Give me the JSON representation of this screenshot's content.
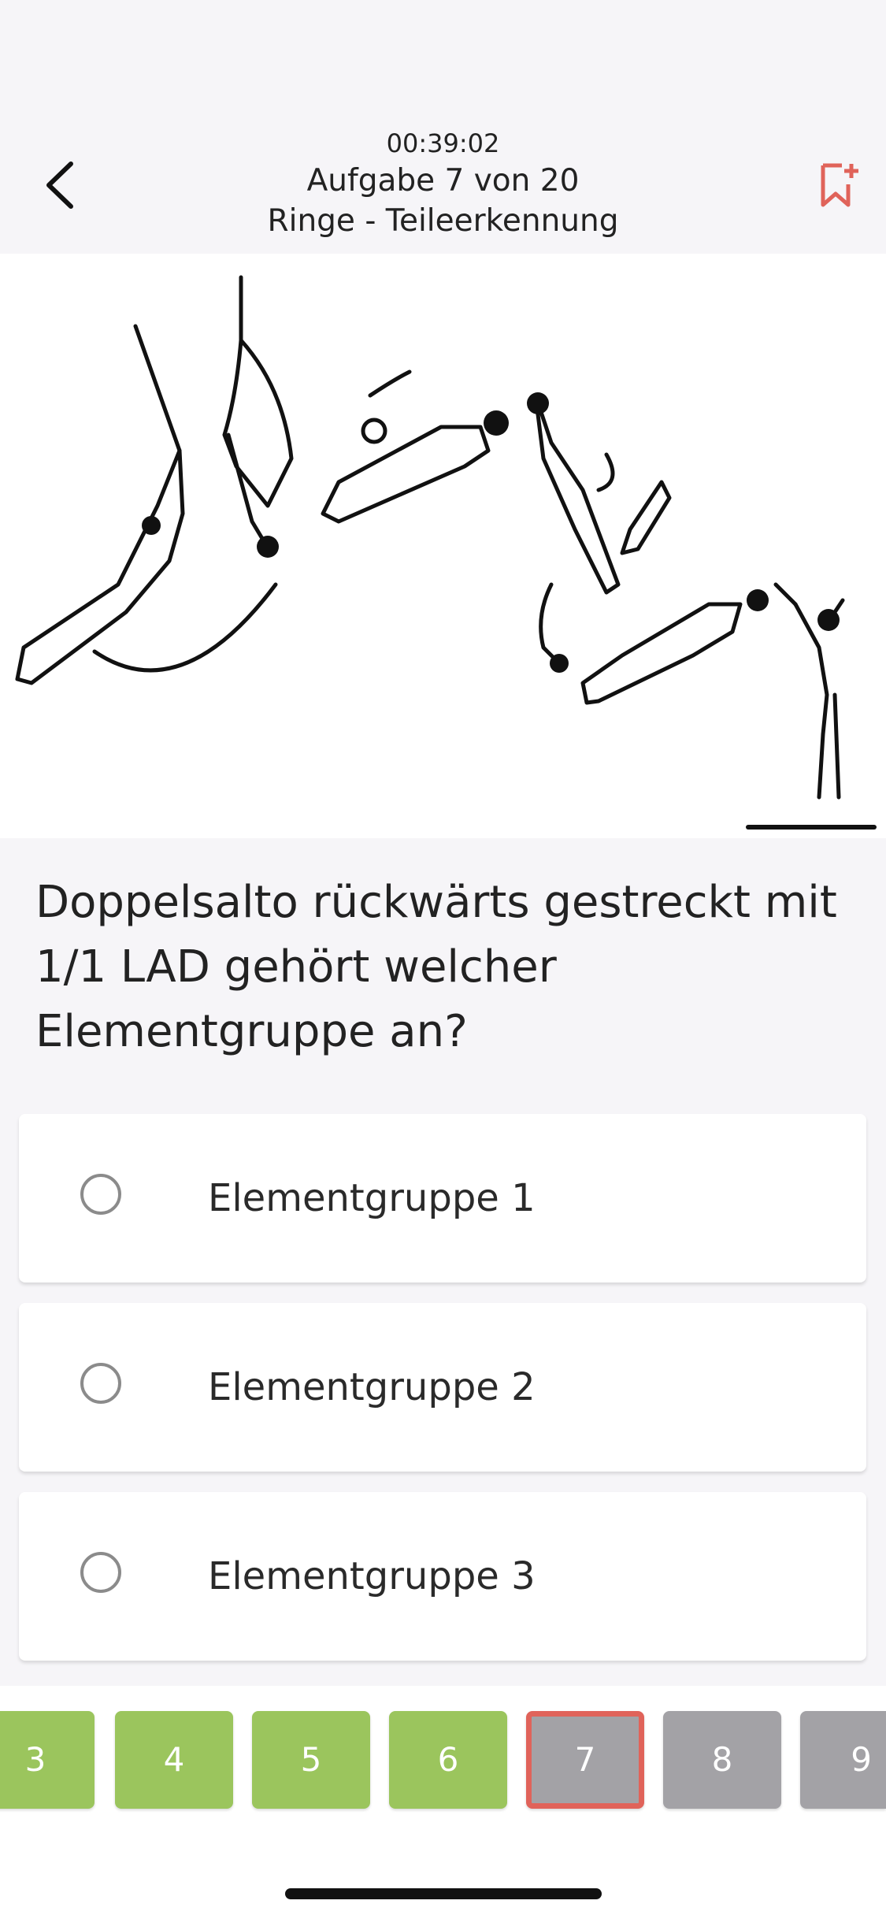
{
  "header": {
    "timer": "00:39:02",
    "title": "Aufgabe 7 von 20",
    "subtitle": "Ringe - Teileerkennung",
    "back_icon": "chevron-left-icon",
    "bookmark_icon": "bookmark-add-icon",
    "bookmark_color": "#e0635a"
  },
  "question": {
    "text": "Doppelsalto rückwärts gestreckt mit 1/1 LAD gehört welcher Elementgruppe an?"
  },
  "options": [
    {
      "label": "Elementgruppe 1",
      "selected": false
    },
    {
      "label": "Elementgruppe 2",
      "selected": false
    },
    {
      "label": "Elementgruppe 3",
      "selected": false
    }
  ],
  "pagination": {
    "items": [
      {
        "label": "3",
        "state": "done"
      },
      {
        "label": "4",
        "state": "done"
      },
      {
        "label": "5",
        "state": "done"
      },
      {
        "label": "6",
        "state": "done"
      },
      {
        "label": "7",
        "state": "current"
      },
      {
        "label": "8",
        "state": "pending"
      },
      {
        "label": "9",
        "state": "pending"
      }
    ],
    "colors": {
      "done": "#9bc55d",
      "pending": "#a3a2a6",
      "current_border": "#e0635a"
    }
  }
}
